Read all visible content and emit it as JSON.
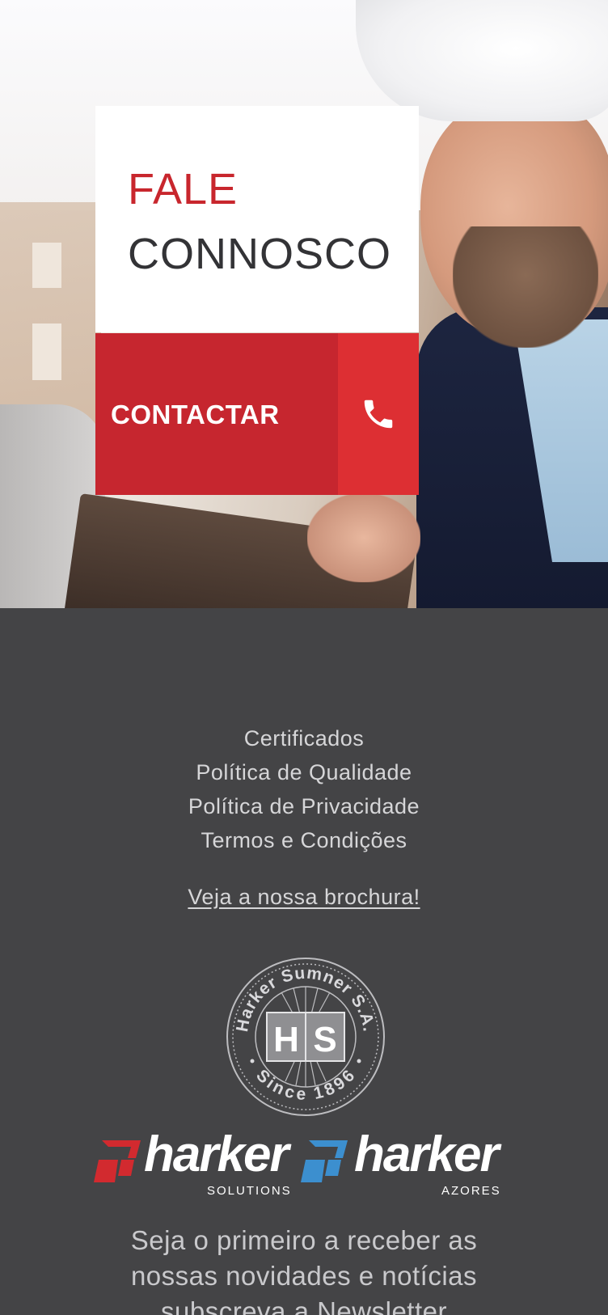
{
  "hero": {
    "title_line1": "FALE",
    "title_line2": "CONNOSCO",
    "cta_label": "CONTACTAR",
    "cta_icon": "phone-icon",
    "colors": {
      "accent_red": "#c6262f",
      "accent_red_light": "#dd2f33",
      "title_dark": "#333336"
    }
  },
  "footer": {
    "links": [
      "Certificados",
      "Política de Qualidade",
      "Política de Privacidade",
      "Termos e Condições"
    ],
    "brochure_link": "Veja a nossa brochura!",
    "seal": {
      "top_text": "Harker Sumner S.A.",
      "bottom_text": "Since 1896",
      "monogram_left": "H",
      "monogram_right": "S"
    },
    "logos": [
      {
        "name": "harker",
        "subtitle": "SOLUTIONS",
        "mark_color": "#d22a2f"
      },
      {
        "name": "harker",
        "subtitle": "AZORES",
        "mark_color": "#3c8fcf"
      }
    ],
    "newsletter_lines": [
      "Seja o primeiro a receber as",
      "nossas novidades e notícias",
      "subscreva a Newsletter"
    ],
    "colors": {
      "background": "#444446",
      "text": "#d6d6d8"
    }
  }
}
